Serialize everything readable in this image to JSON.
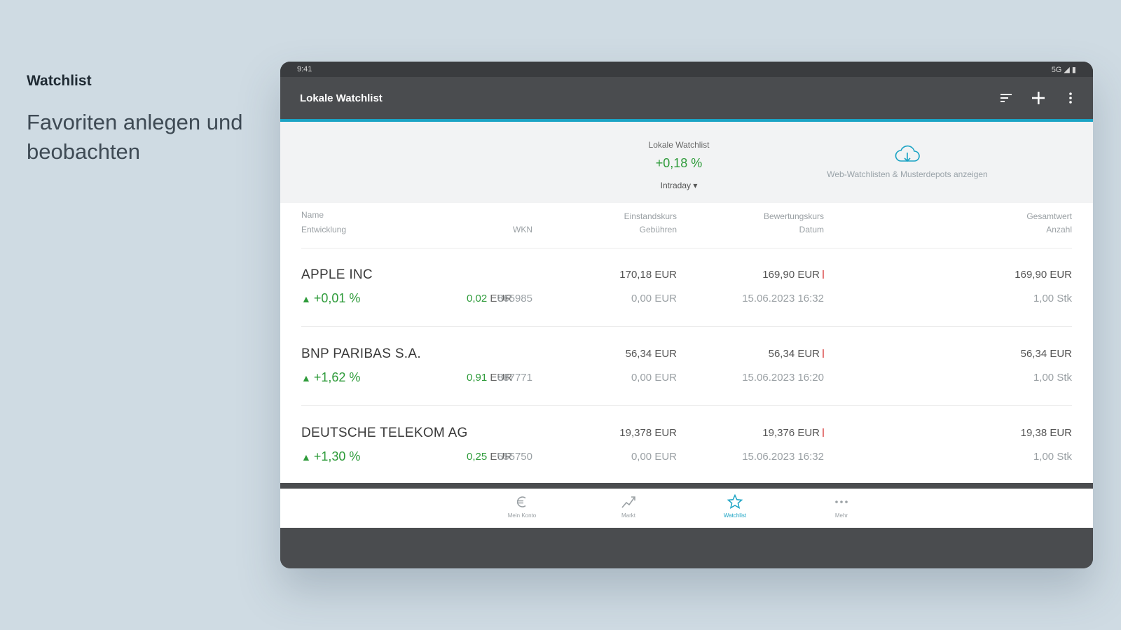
{
  "promo": {
    "title": "Watchlist",
    "subtitle": "Favoriten anlegen und beobachten"
  },
  "status": {
    "time": "9:41",
    "right": "5G ◢ ▮"
  },
  "appbar": {
    "title": "Lokale Watchlist"
  },
  "summary": {
    "label": "Lokale Watchlist",
    "value": "+0,18 %",
    "period": "Intraday ▾",
    "cloud_text": "Web-Watchlisten & Musterdepots anzeigen"
  },
  "headers": {
    "name": "Name",
    "entwicklung": "Entwicklung",
    "wkn": "WKN",
    "einstandskurs": "Einstandskurs",
    "gebuehren": "Gebühren",
    "bewertungskurs": "Bewertungskurs",
    "datum": "Datum",
    "gesamtwert": "Gesamtwert",
    "anzahl": "Anzahl"
  },
  "rows": [
    {
      "name": "APPLE INC",
      "change": "+0,01 %",
      "abs": "0,02",
      "cur": "EUR",
      "wkn": "865985",
      "ek": "170,18 EUR",
      "geb": "0,00 EUR",
      "bk": "169,90 EUR",
      "date": "15.06.2023 16:32",
      "gw": "169,90 EUR",
      "anz": "1,00 Stk"
    },
    {
      "name": "BNP PARIBAS S.A.",
      "change": "+1,62 %",
      "abs": "0,91",
      "cur": "EUR",
      "wkn": "887771",
      "ek": "56,34 EUR",
      "geb": "0,00 EUR",
      "bk": "56,34 EUR",
      "date": "15.06.2023 16:20",
      "gw": "56,34 EUR",
      "anz": "1,00 Stk"
    },
    {
      "name": "DEUTSCHE TELEKOM AG",
      "change": "+1,30 %",
      "abs": "0,25",
      "cur": "EUR",
      "wkn": "555750",
      "ek": "19,378 EUR",
      "geb": "0,00 EUR",
      "bk": "19,376 EUR",
      "date": "15.06.2023 16:32",
      "gw": "19,38 EUR",
      "anz": "1,00 Stk"
    }
  ],
  "nav": {
    "items": [
      {
        "label": "Mein Konto"
      },
      {
        "label": "Markt"
      },
      {
        "label": "Watchlist"
      },
      {
        "label": "Mehr"
      }
    ]
  },
  "colors": {
    "accent": "#1aa3c4",
    "positive": "#2e9b3a",
    "appbar": "#4a4c4f"
  }
}
